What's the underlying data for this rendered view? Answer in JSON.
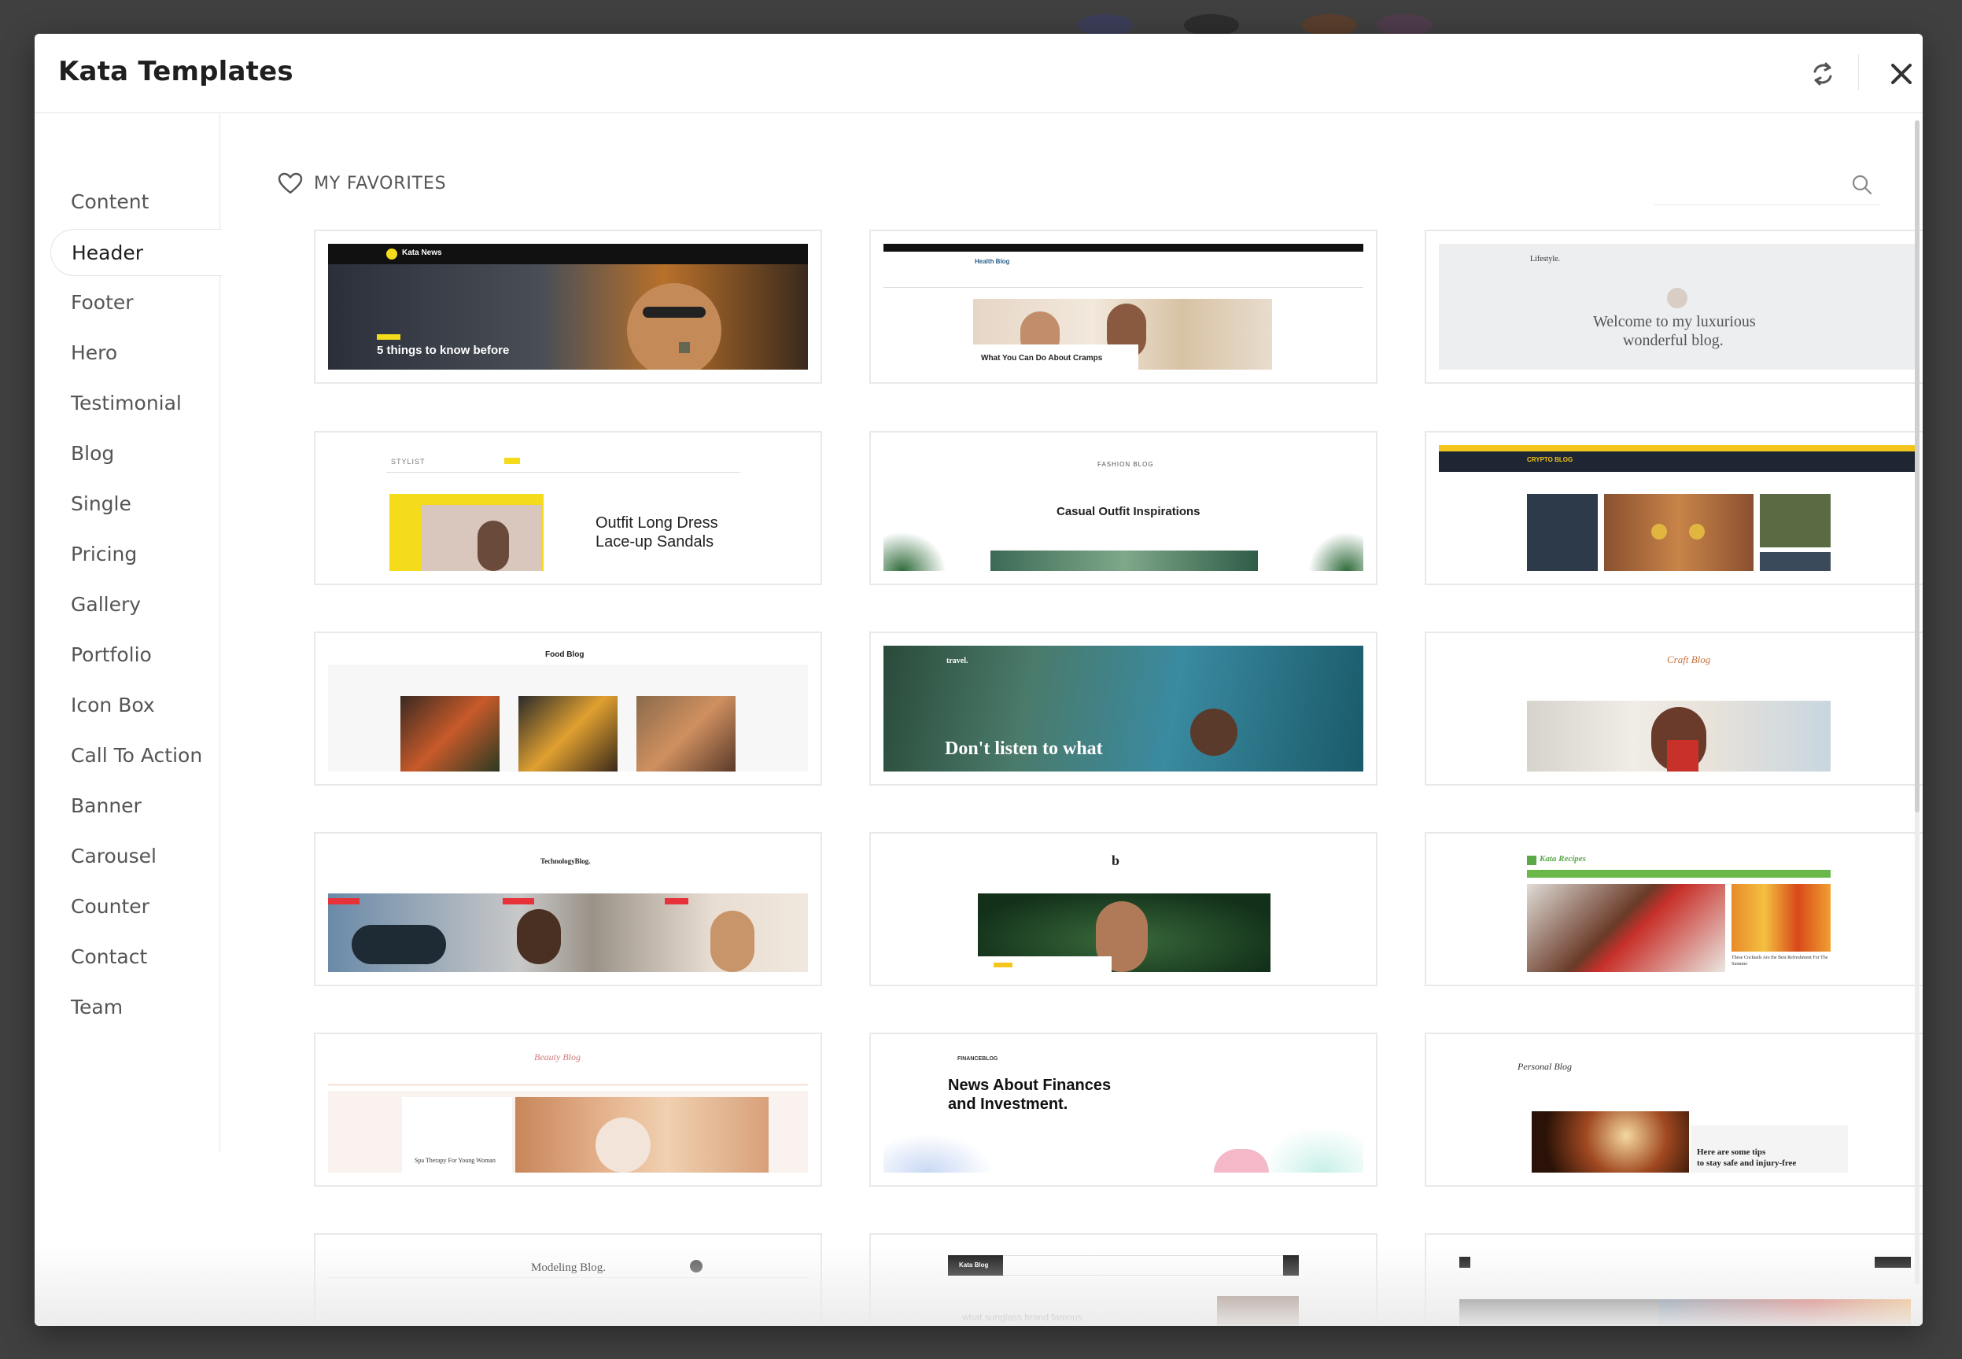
{
  "modal": {
    "title": "Kata Templates"
  },
  "sidebar": {
    "items": [
      {
        "label": "Content"
      },
      {
        "label": "Header",
        "active": true
      },
      {
        "label": "Footer"
      },
      {
        "label": "Hero"
      },
      {
        "label": "Testimonial"
      },
      {
        "label": "Blog"
      },
      {
        "label": "Single"
      },
      {
        "label": "Pricing"
      },
      {
        "label": "Gallery"
      },
      {
        "label": "Portfolio"
      },
      {
        "label": "Icon Box"
      },
      {
        "label": "Call To Action"
      },
      {
        "label": "Banner"
      },
      {
        "label": "Carousel"
      },
      {
        "label": "Counter"
      },
      {
        "label": "Contact"
      },
      {
        "label": "Team"
      }
    ]
  },
  "favorites": {
    "label": "MY FAVORITES"
  },
  "search": {
    "placeholder": "",
    "value": ""
  },
  "templates": [
    {
      "brand": "Kata News",
      "headline": "5 things to know before"
    },
    {
      "brand": "Health Blog",
      "headline": "What You Can Do About Cramps"
    },
    {
      "brand": "Lifestyle.",
      "headline": "Welcome to my luxurious",
      "headline2": "wonderful blog."
    },
    {
      "brand": "STYLIST",
      "headline": "Outfit Long Dress",
      "headline2": "Lace-up Sandals"
    },
    {
      "brand": "FASHION BLOG",
      "headline": "Casual Outfit Inspirations"
    },
    {
      "brand": "CRYPTO BLOG",
      "headline": ""
    },
    {
      "brand": "Food Blog",
      "headline": ""
    },
    {
      "brand": "travel.",
      "headline": "Don't listen to what"
    },
    {
      "brand": "Craft Blog",
      "headline": ""
    },
    {
      "brand": "TechnologyBlog.",
      "headline": ""
    },
    {
      "brand": "b",
      "headline": ""
    },
    {
      "brand": "Kata Recipes",
      "headline": "These Cocktails Are the Best Refreshment For The Summer"
    },
    {
      "brand": "Beauty Blog",
      "headline": "Spa Therapy For Young Woman"
    },
    {
      "brand": "FINANCEBLOG",
      "headline": "News About Finances",
      "headline2": "and Investment."
    },
    {
      "brand": "Personal Blog",
      "headline": "Here are some tips",
      "headline2": "to stay safe and injury-free"
    },
    {
      "brand": "Modeling Blog.",
      "headline": ""
    },
    {
      "brand": "Kata Blog",
      "headline": "what sunglass brand famous"
    },
    {
      "brand": "",
      "headline": ""
    }
  ],
  "colors": {
    "accent_yellow": "#f4dc1c",
    "backdrop": "#3f3f3f",
    "border": "#e9e9e9"
  },
  "icons": {
    "refresh": "refresh-icon",
    "close": "close-icon",
    "heart": "heart-icon",
    "search": "search-icon"
  }
}
